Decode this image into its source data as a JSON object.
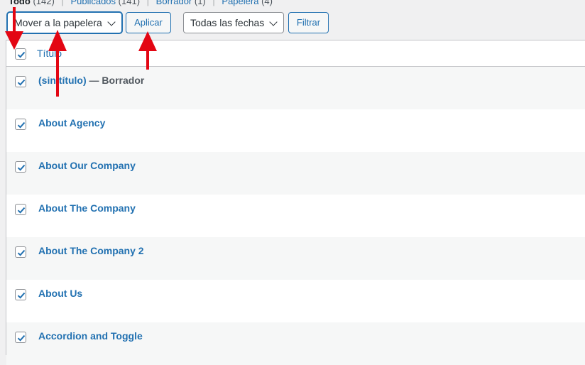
{
  "subsubsub": {
    "all_label": "Todo",
    "all_count": "(142)",
    "published_label": "Publicados",
    "published_count": "(141)",
    "draft_label": "Borrador",
    "draft_count": "(1)",
    "trash_label": "Papelera",
    "trash_count": "(4)",
    "separator": "|"
  },
  "tablenav": {
    "bulk_action_selected": "Mover a la papelera",
    "apply_label": "Aplicar",
    "date_filter_selected": "Todas las fechas",
    "filter_label": "Filtrar"
  },
  "table": {
    "header_title": "Título",
    "rows": [
      {
        "title": "(sin título)",
        "state": " — Borrador",
        "checked": true
      },
      {
        "title": "About Agency",
        "state": "",
        "checked": true
      },
      {
        "title": "About Our Company",
        "state": "",
        "checked": true
      },
      {
        "title": "About The Company",
        "state": "",
        "checked": true
      },
      {
        "title": "About The Company 2",
        "state": "",
        "checked": true
      },
      {
        "title": "About Us",
        "state": "",
        "checked": true
      },
      {
        "title": "Accordion and Toggle",
        "state": "",
        "checked": true
      }
    ]
  },
  "colors": {
    "link": "#2271b1",
    "annotation_arrow": "#e30613",
    "row_alt": "#f6f7f7"
  }
}
